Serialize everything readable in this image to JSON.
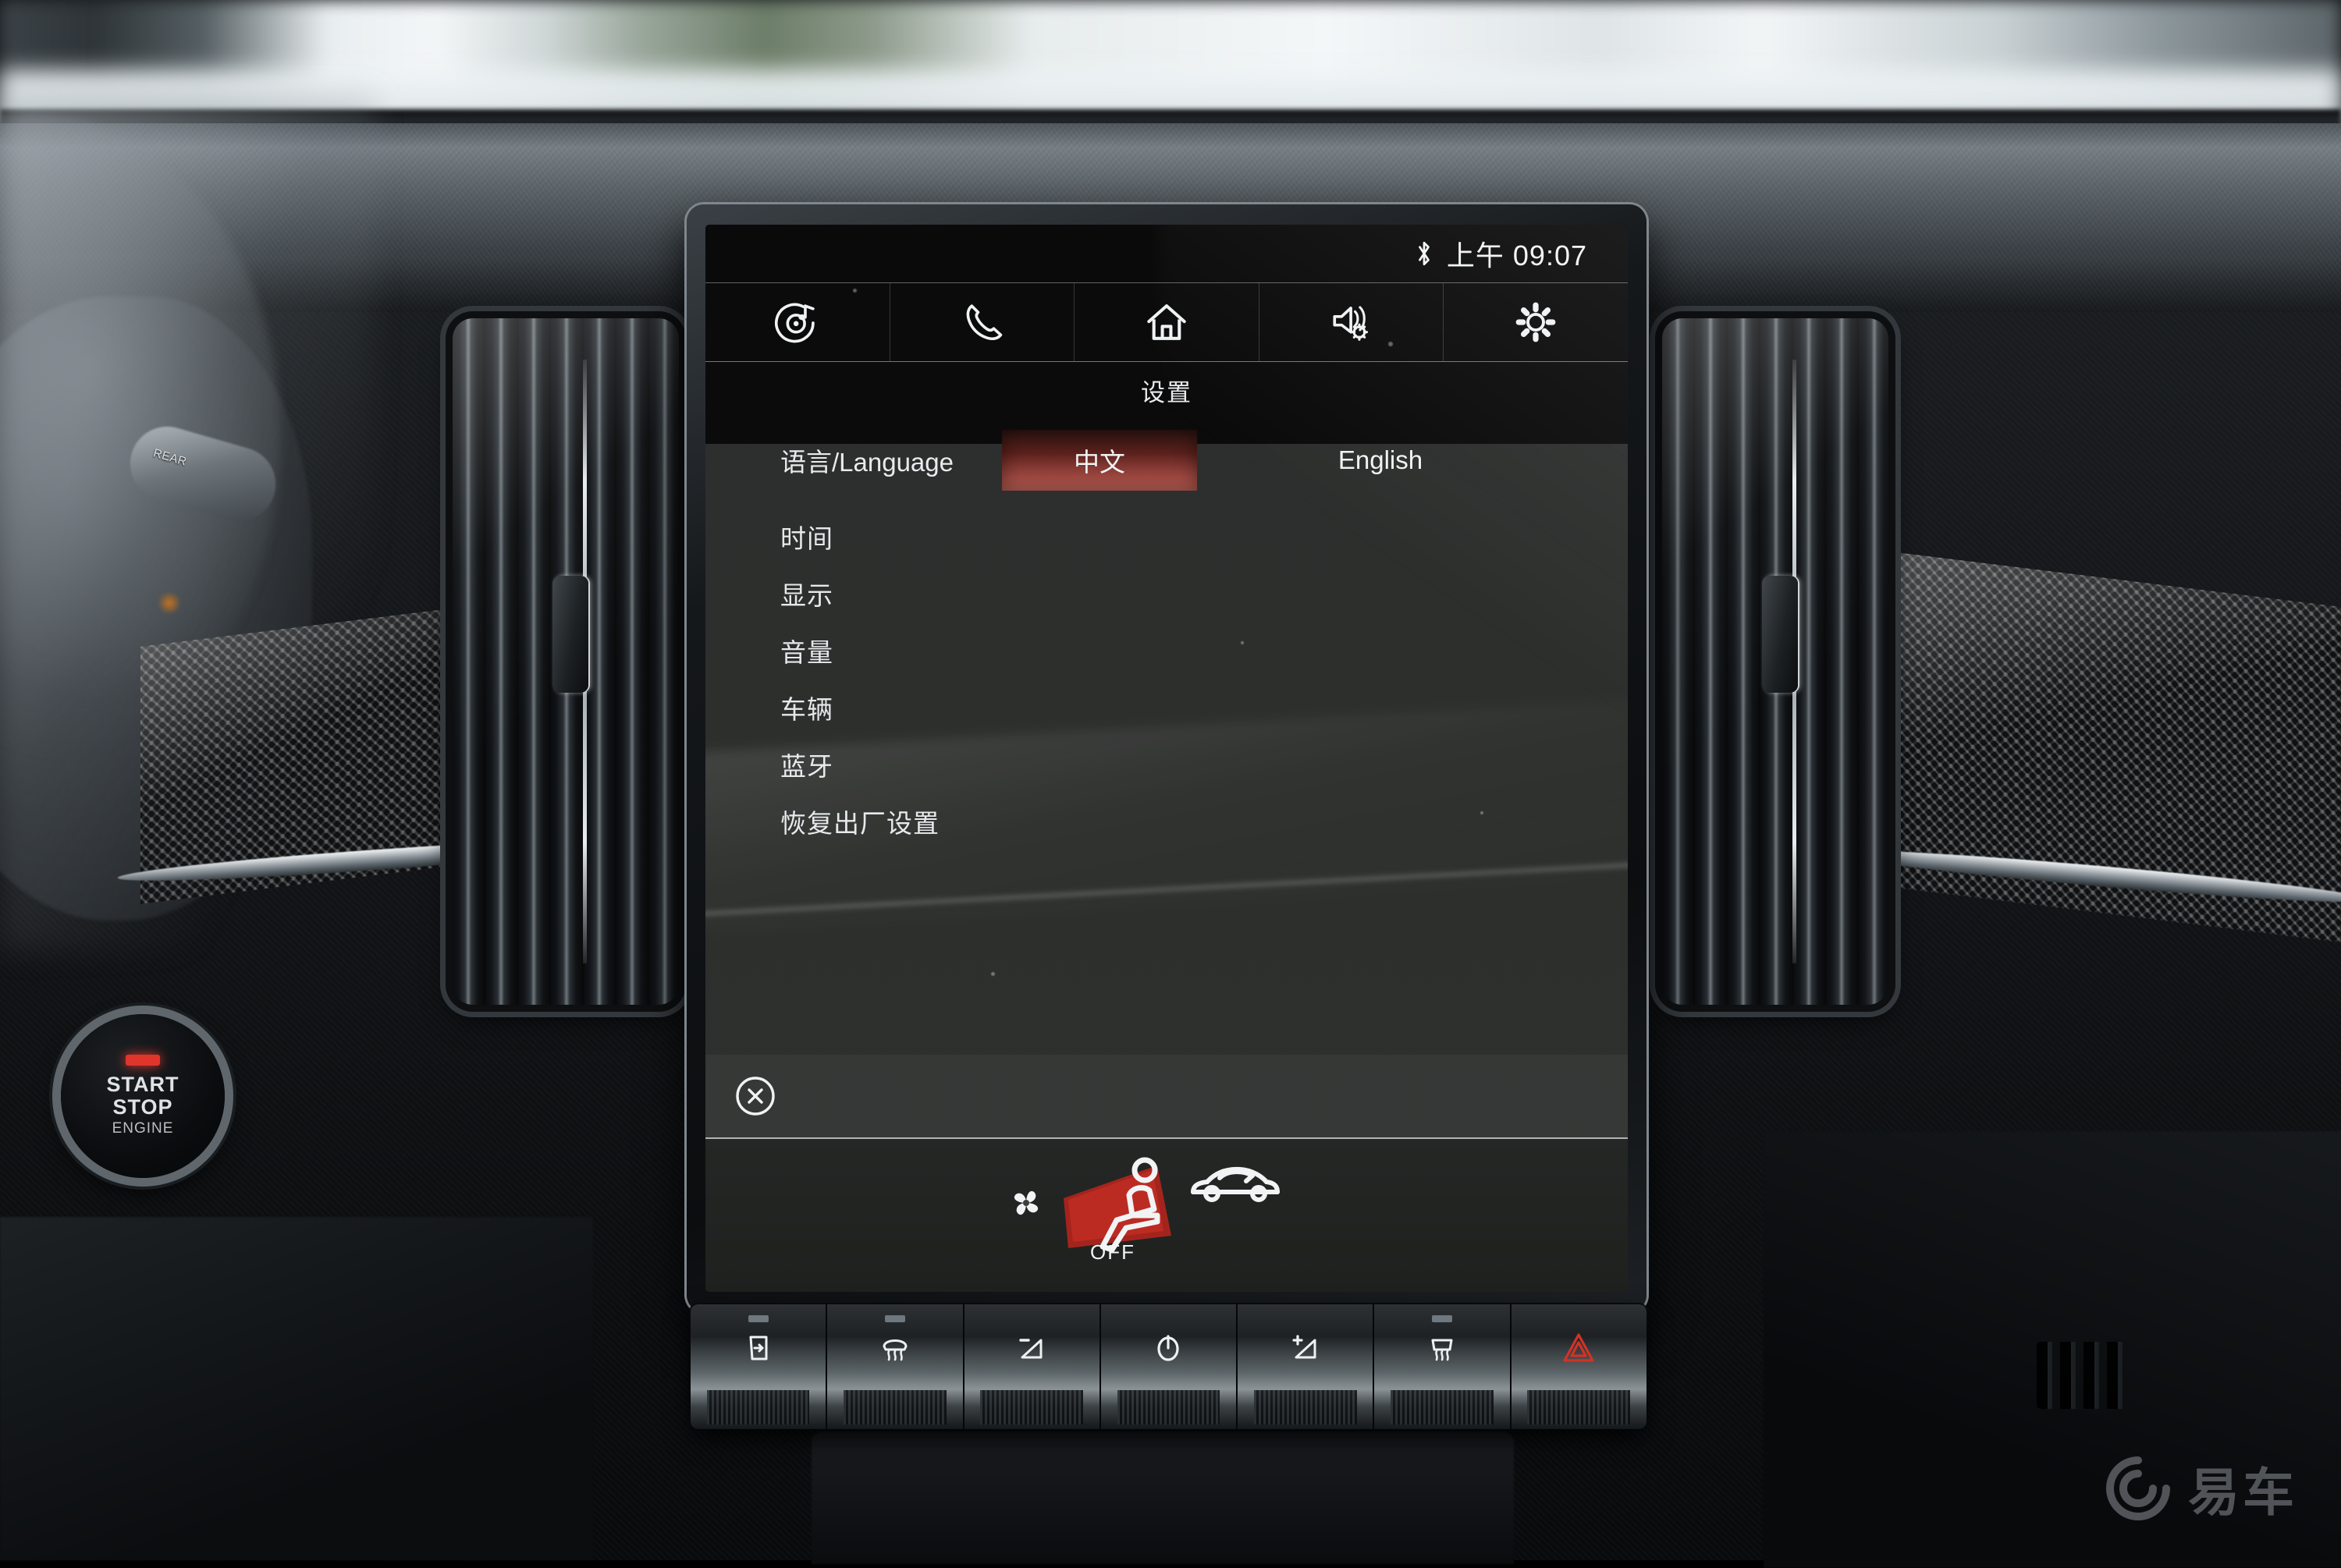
{
  "statusbar": {
    "bluetooth_icon": "bluetooth-icon",
    "time": "上午 09:07"
  },
  "toolbar": {
    "items": [
      {
        "name": "media-icon",
        "label": "媒体"
      },
      {
        "name": "phone-icon",
        "label": "电话"
      },
      {
        "name": "home-icon",
        "label": "主页"
      },
      {
        "name": "sound-settings-icon",
        "label": "音效设置"
      },
      {
        "name": "settings-gear-icon",
        "label": "设置"
      }
    ]
  },
  "page": {
    "title": "设置"
  },
  "language_row": {
    "label": "语言/Language",
    "options": [
      {
        "label": "中文",
        "selected": true
      },
      {
        "label": "English",
        "selected": false
      }
    ],
    "selected_highlight_color": "#a24a42"
  },
  "menu": {
    "items": [
      {
        "label": "时间"
      },
      {
        "label": "显示"
      },
      {
        "label": "音量"
      },
      {
        "label": "车辆"
      },
      {
        "label": "蓝牙"
      },
      {
        "label": "恢复出厂设置"
      }
    ]
  },
  "bottom_bar": {
    "close_icon": "close-circle-icon"
  },
  "climate_bar": {
    "fan_icon": "fan-icon",
    "seat_airflow_icon": "seat-airflow-icon",
    "recirculation_icon": "air-recirculation-car-icon",
    "status_label": "OFF",
    "airflow_color": "#c0271f"
  },
  "hard_buttons": {
    "items": [
      {
        "name": "window-defog-button",
        "has_led": true,
        "led_color": "#6e787e"
      },
      {
        "name": "front-defrost-button",
        "has_led": true,
        "led_color": "#6e787e"
      },
      {
        "name": "volume-down-button",
        "has_led": false
      },
      {
        "name": "power-button",
        "has_led": false
      },
      {
        "name": "volume-up-button",
        "has_led": false
      },
      {
        "name": "rear-defrost-button",
        "has_led": true,
        "led_color": "#6e787e"
      },
      {
        "name": "hazard-lights-button",
        "has_led": false,
        "accent_color": "#d23226"
      }
    ]
  },
  "start_stop": {
    "line1": "START",
    "line2": "STOP",
    "line3": "ENGINE",
    "led_color": "#e0352b"
  },
  "stalk": {
    "label": "REAR"
  },
  "watermark": {
    "text": "易车",
    "mark": "yiche-logo-icon"
  }
}
